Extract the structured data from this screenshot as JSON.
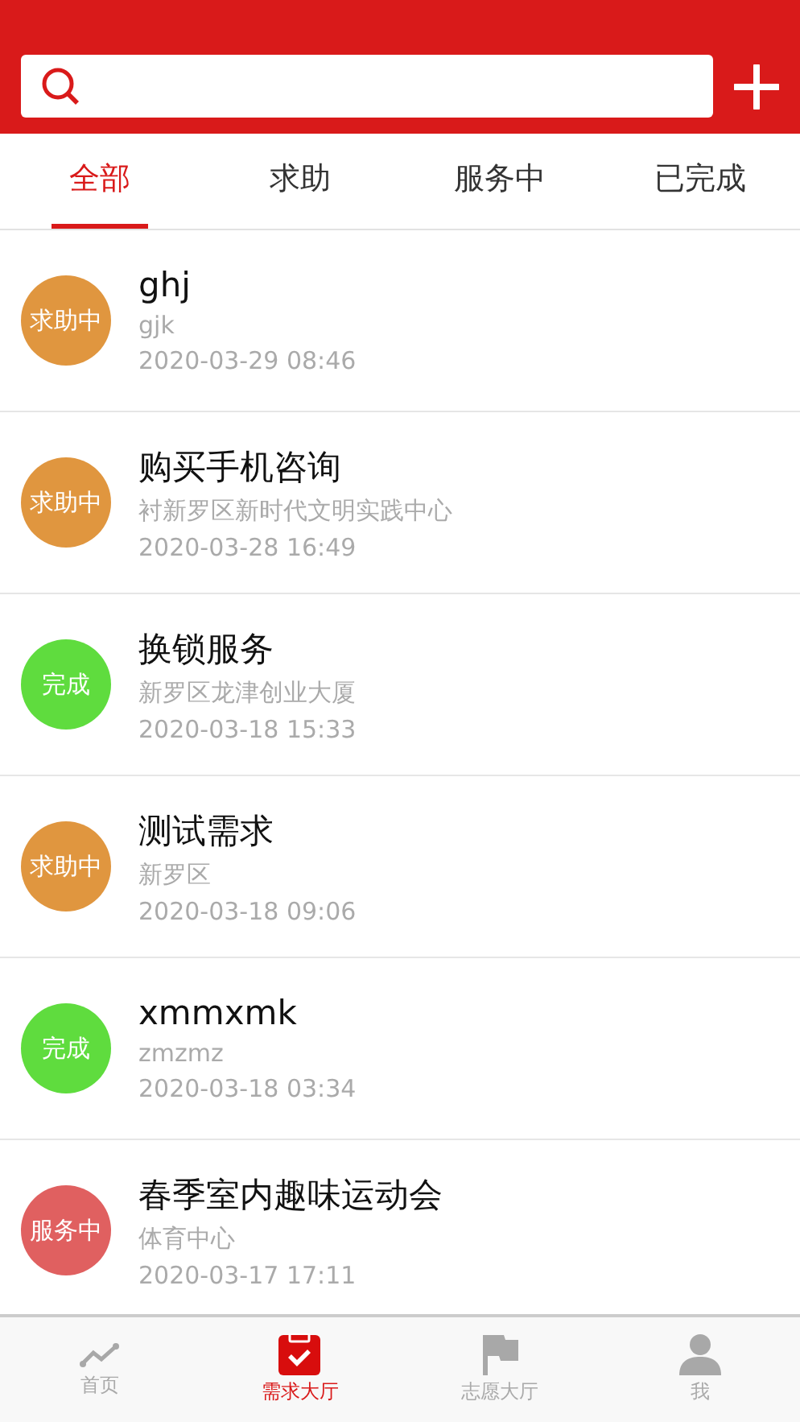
{
  "tabs": [
    {
      "label": "全部",
      "selected": true
    },
    {
      "label": "求助",
      "selected": false
    },
    {
      "label": "服务中",
      "selected": false
    },
    {
      "label": "已完成",
      "selected": false
    }
  ],
  "requests": [
    {
      "status": "求助中",
      "color": "#e0963f",
      "title": "ghj",
      "location": "gjk",
      "time": "2020-03-29 08:46"
    },
    {
      "status": "求助中",
      "color": "#e0963f",
      "title": "购买手机咨询",
      "location": "衬新罗区新时代文明实践中心",
      "time": "2020-03-28 16:49"
    },
    {
      "status": "完成",
      "color": "#5fdc3e",
      "title": "换锁服务",
      "location": "新罗区龙津创业大厦",
      "time": "2020-03-18 15:33"
    },
    {
      "status": "求助中",
      "color": "#e0963f",
      "title": "测试需求",
      "location": "新罗区",
      "time": "2020-03-18 09:06"
    },
    {
      "status": "完成",
      "color": "#5fdc3e",
      "title": "xmmxmk",
      "location": "zmzmz",
      "time": "2020-03-18 03:34"
    },
    {
      "status": "服务中",
      "color": "#e06060",
      "title": "春季室内趣味运动会",
      "location": "体育中心",
      "time": "2020-03-17 17:11"
    }
  ],
  "bottom_nav": [
    {
      "label": "首页",
      "kind": "trend",
      "selected": false
    },
    {
      "label": "需求大厅",
      "kind": "clipboard",
      "selected": true
    },
    {
      "label": "志愿大厅",
      "kind": "flag",
      "selected": false
    },
    {
      "label": "我",
      "kind": "person",
      "selected": false
    }
  ]
}
